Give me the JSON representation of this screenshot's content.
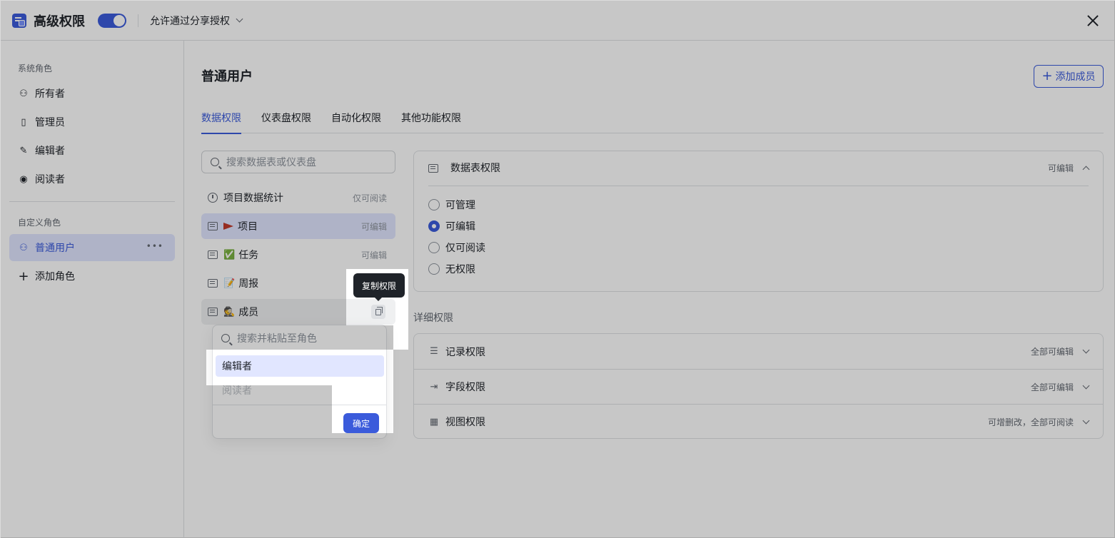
{
  "header": {
    "title": "高级权限",
    "toggle_on": true,
    "share_mode": "允许通过分享授权"
  },
  "sidebar": {
    "system_section": "系统角色",
    "system_roles": [
      {
        "label": "所有者",
        "icon": "owner-icon"
      },
      {
        "label": "管理员",
        "icon": "admin-icon"
      },
      {
        "label": "编辑者",
        "icon": "edit-icon"
      },
      {
        "label": "阅读者",
        "icon": "eye-icon"
      }
    ],
    "custom_section": "自定义角色",
    "custom_roles": [
      {
        "label": "普通用户",
        "icon": "user-icon",
        "active": true
      }
    ],
    "add_role": "添加角色"
  },
  "main": {
    "title": "普通用户",
    "add_member": "添加成员",
    "tabs": [
      "数据权限",
      "仪表盘权限",
      "自动化权限",
      "其他功能权限"
    ],
    "active_tab": 0,
    "search_placeholder": "搜索数据表或仪表盘",
    "tables": [
      {
        "name": "项目数据统计",
        "permission": "仅可阅读",
        "icon": "dashboard-icon"
      },
      {
        "name": "项目",
        "permission": "可编辑",
        "emoji": "red-flag-icon",
        "selected": true
      },
      {
        "name": "任务",
        "permission": "可编辑",
        "emoji": "✅"
      },
      {
        "name": "周报",
        "permission": "",
        "emoji": "📝"
      },
      {
        "name": "成员",
        "permission": "",
        "emoji": "🕵"
      }
    ],
    "tooltip": "复制权限",
    "copy_popover": {
      "search_placeholder": "搜索并粘贴至角色",
      "options": [
        {
          "label": "编辑者",
          "selected": true
        },
        {
          "label": "阅读者",
          "disabled": true
        }
      ],
      "confirm": "确定"
    }
  },
  "table_permission": {
    "title": "数据表权限",
    "status": "可编辑",
    "options": [
      "可管理",
      "可编辑",
      "仅可阅读",
      "无权限"
    ],
    "selected": 1
  },
  "detail": {
    "label": "详细权限",
    "rows": [
      {
        "name": "记录权限",
        "status": "全部可编辑",
        "icon": "list-icon"
      },
      {
        "name": "字段权限",
        "status": "全部可编辑",
        "icon": "field-icon"
      },
      {
        "name": "视图权限",
        "status": "可增删改，全部可阅读",
        "icon": "grid-icon"
      }
    ]
  },
  "colors": {
    "accent": "#3b5bdb",
    "selected_bg": "#e1e6ff",
    "tooltip_bg": "#1f2329"
  }
}
